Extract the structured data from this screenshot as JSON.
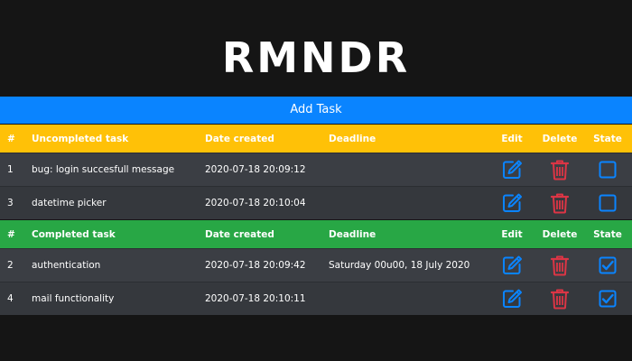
{
  "app": {
    "title": "RMNDR"
  },
  "add_task": {
    "label": "Add Task"
  },
  "colors": {
    "primary": "#0a84ff",
    "warning": "#ffc107",
    "success": "#28a745",
    "danger": "#dc3545",
    "background": "#151515"
  },
  "uncompleted": {
    "headers": {
      "num": "#",
      "name": "Uncompleted task",
      "date": "Date created",
      "deadline": "Deadline",
      "edit": "Edit",
      "delete": "Delete",
      "state": "State"
    },
    "rows": [
      {
        "num": "1",
        "name": "bug: login succesfull message",
        "date": "2020-07-18 20:09:12",
        "deadline": "",
        "checked": false
      },
      {
        "num": "3",
        "name": "datetime picker",
        "date": "2020-07-18 20:10:04",
        "deadline": "",
        "checked": false
      }
    ]
  },
  "completed": {
    "headers": {
      "num": "#",
      "name": "Completed task",
      "date": "Date created",
      "deadline": "Deadline",
      "edit": "Edit",
      "delete": "Delete",
      "state": "State"
    },
    "rows": [
      {
        "num": "2",
        "name": "authentication",
        "date": "2020-07-18 20:09:42",
        "deadline": "Saturday 00u00, 18 July 2020",
        "checked": true
      },
      {
        "num": "4",
        "name": "mail functionality",
        "date": "2020-07-18 20:10:11",
        "deadline": "",
        "checked": true
      }
    ]
  },
  "icons": {
    "edit": "pencil-square-icon",
    "delete": "trash-icon",
    "state_unchecked": "checkbox-unchecked-icon",
    "state_checked": "checkbox-checked-icon"
  }
}
